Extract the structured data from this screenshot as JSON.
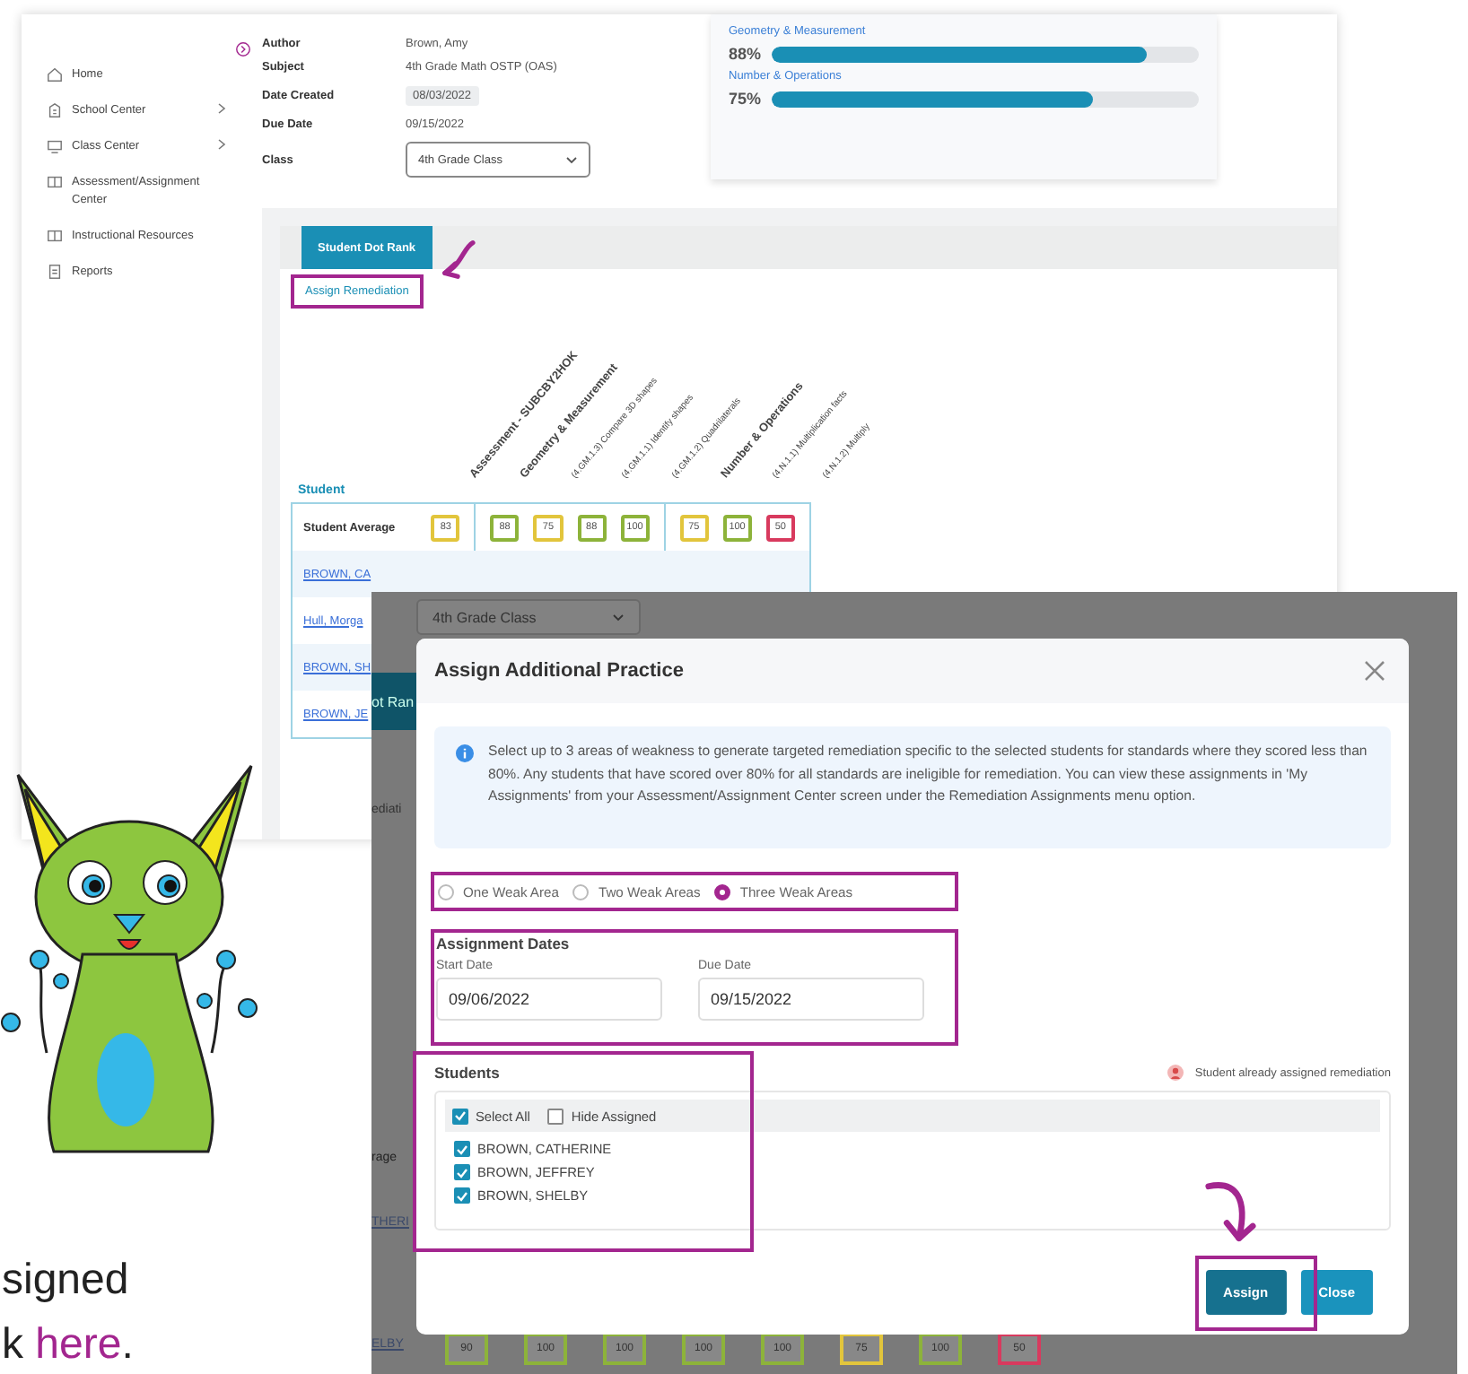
{
  "back_window": {
    "sidebar": [
      {
        "label": "Home",
        "kind": "home",
        "has_submenu": false
      },
      {
        "label": "School Center",
        "kind": "building",
        "has_submenu": true
      },
      {
        "label": "Class Center",
        "kind": "monitor",
        "has_submenu": true
      },
      {
        "label": "Assessment/Assignment Center",
        "kind": "book",
        "has_submenu": false
      },
      {
        "label": "Instructional Resources",
        "kind": "book",
        "has_submenu": false
      },
      {
        "label": "Reports",
        "kind": "doc",
        "has_submenu": false
      }
    ],
    "details": [
      {
        "label": "Author",
        "value": "Brown, Amy",
        "kind": "text"
      },
      {
        "label": "Subject",
        "value": "4th Grade Math OSTP (OAS)",
        "kind": "text"
      },
      {
        "label": "Date Created",
        "value": "08/03/2022",
        "kind": "chip"
      },
      {
        "label": "Due Date",
        "value": "09/15/2022",
        "kind": "text"
      },
      {
        "label": "Class",
        "value": "4th Grade Class",
        "kind": "select"
      }
    ],
    "progress": [
      {
        "label": "Geometry & Measurement",
        "reading": "88%",
        "level": 0.88
      },
      {
        "label": "Number & Operations",
        "reading": "75%",
        "level": 0.75
      }
    ],
    "tab": {
      "label": "Student Dot Rank",
      "selected": true
    },
    "action_link": "Assign Remediation",
    "columns": [
      "Assessment - SUBCBY2HOK",
      "Geometry & Measurement",
      "(4.GM.1.3) Compare 3D shapes",
      "(4.GM.1.1) Identify shapes",
      "(4.GM.1.2) Quadrilaterals",
      "Number & Operations",
      "(4.N.1.1) Multiplication facts",
      "(4.N.1.2) Multiply"
    ],
    "student_header": "Student",
    "average_row": {
      "label": "Student Average",
      "scores": [
        {
          "value": "83",
          "color": "#e2c53c",
          "divider_before": false
        },
        {
          "value": "88",
          "color": "#8db33a",
          "divider_before": true
        },
        {
          "value": "75",
          "color": "#e2c53c",
          "divider_before": false
        },
        {
          "value": "88",
          "color": "#8db33a",
          "divider_before": false
        },
        {
          "value": "100",
          "color": "#8db33a",
          "divider_before": false
        },
        {
          "value": "75",
          "color": "#e2c53c",
          "divider_before": true
        },
        {
          "value": "100",
          "color": "#8db33a",
          "divider_before": false
        },
        {
          "value": "50",
          "color": "#d83a5e",
          "divider_before": false
        }
      ]
    },
    "student_links": [
      "BROWN, CA",
      "Hull, Morga",
      "BROWN, SH",
      "BROWN, JE"
    ]
  },
  "front_window": {
    "behind": {
      "class_select": "4th Grade Class",
      "tab_fragment": "ot Ran",
      "link_fragment": "ediati",
      "row_label_fragment": "rage",
      "student_fragments": [
        "THERI",
        "ELBY"
      ],
      "scores": [
        {
          "value": "90",
          "color": "#8db33a"
        },
        {
          "value": "100",
          "color": "#8db33a"
        },
        {
          "value": "100",
          "color": "#8db33a"
        },
        {
          "value": "100",
          "color": "#8db33a"
        },
        {
          "value": "100",
          "color": "#8db33a"
        },
        {
          "value": "75",
          "color": "#e2c53c"
        },
        {
          "value": "100",
          "color": "#8db33a"
        },
        {
          "value": "50",
          "color": "#d83a5e"
        }
      ]
    },
    "dialog": {
      "title": "Assign Additional Practice",
      "info": "Select up to 3 areas of weakness to generate targeted remediation specific to the selected students for standards where they scored less than 80%. Any students that have scored over 80% for all standards are ineligible for remediation. You can view these assignments in 'My Assignments' from your Assessment/Assignment Center screen under the Remediation Assignments menu option.",
      "weak_areas": [
        {
          "label": "One Weak Area",
          "selected": false
        },
        {
          "label": "Two Weak Areas",
          "selected": false
        },
        {
          "label": "Three Weak Areas",
          "selected": true
        }
      ],
      "dates_heading": "Assignment Dates",
      "dates": [
        {
          "label": "Start Date",
          "value": "09/06/2022"
        },
        {
          "label": "Due Date",
          "value": "09/15/2022"
        }
      ],
      "students_heading": "Students",
      "legend": "Student already assigned remediation",
      "list_options": [
        {
          "label": "Select All",
          "checked": true
        },
        {
          "label": "Hide Assigned",
          "checked": false
        }
      ],
      "students": [
        {
          "name": "BROWN, CATHERINE",
          "checked": true
        },
        {
          "name": "BROWN, JEFFREY",
          "checked": true
        },
        {
          "name": "BROWN, SHELBY",
          "checked": true
        }
      ],
      "buttons": [
        {
          "label": "Assign",
          "kind": "primary"
        },
        {
          "label": "Close",
          "kind": "secondary"
        }
      ]
    }
  },
  "caption": {
    "line_1": "signed",
    "line_2_start": "k ",
    "link": "here",
    "line_2_end": "."
  }
}
